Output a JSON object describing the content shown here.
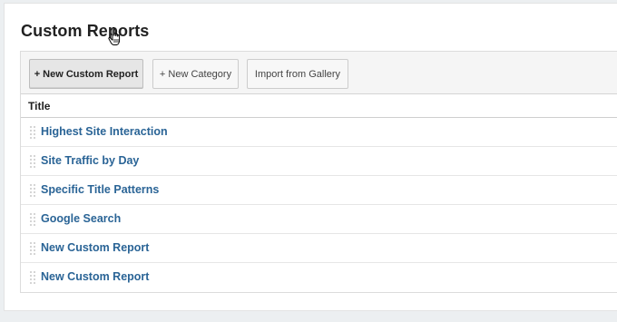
{
  "page": {
    "title": "Custom Reports"
  },
  "toolbar": {
    "new_report_label": "+ New Custom Report",
    "new_category_label": "+ New Category",
    "import_label": "Import from Gallery"
  },
  "table": {
    "column_title": "Title",
    "rows": [
      {
        "title": "Highest Site Interaction"
      },
      {
        "title": "Site Traffic by Day"
      },
      {
        "title": "Specific Title Patterns"
      },
      {
        "title": "Google Search"
      },
      {
        "title": "New Custom Report"
      },
      {
        "title": "New Custom Report"
      }
    ]
  },
  "icons": {
    "cursor": "hand-pointer-icon",
    "drag": "drag-handle-icon"
  },
  "colors": {
    "link": "#2a6496",
    "toolbar_bg": "#f5f5f5",
    "page_bg": "#eceff1"
  }
}
